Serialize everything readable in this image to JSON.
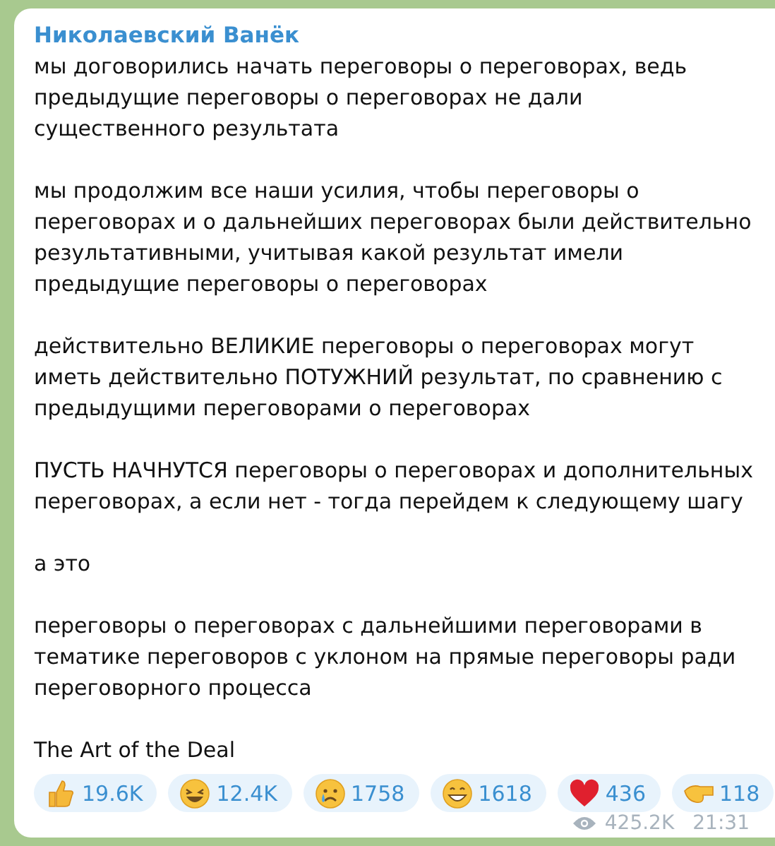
{
  "message": {
    "author": "Николаевский Ванёк",
    "paragraphs": [
      "мы договорились начать переговоры о переговорах, ведь предыдущие переговоры о переговорах не дали существенного результата",
      "мы продолжим все наши усилия, чтобы переговоры о переговорах и о дальнейших переговорах были действительно результативными, учитывая какой результат имели предыдущие переговоры о переговорах",
      "действительно ВЕЛИКИЕ переговоры о переговорах могут иметь действительно ПОТУЖНИЙ результат, по сравнению с предыдущими переговорами о переговорах",
      "ПУСТЬ НАЧНУТСЯ переговоры о переговорах и дополнительных переговорах, а если нет - тогда перейдем к следующему шагу",
      "а это",
      "переговоры о переговорах с дальнейшими переговорами в тематике переговоров с уклоном на прямые переговоры ради переговорного процесса",
      "The Art of the Deal"
    ],
    "reactions": [
      {
        "kind": "thumbs",
        "count": "19.6K"
      },
      {
        "kind": "rofl",
        "count": "12.4K"
      },
      {
        "kind": "cry",
        "count": "1758"
      },
      {
        "kind": "grin",
        "count": "1618"
      },
      {
        "kind": "heart",
        "count": "436"
      },
      {
        "kind": "point",
        "count": "118"
      }
    ],
    "views": "425.2K",
    "time": "21:31"
  }
}
